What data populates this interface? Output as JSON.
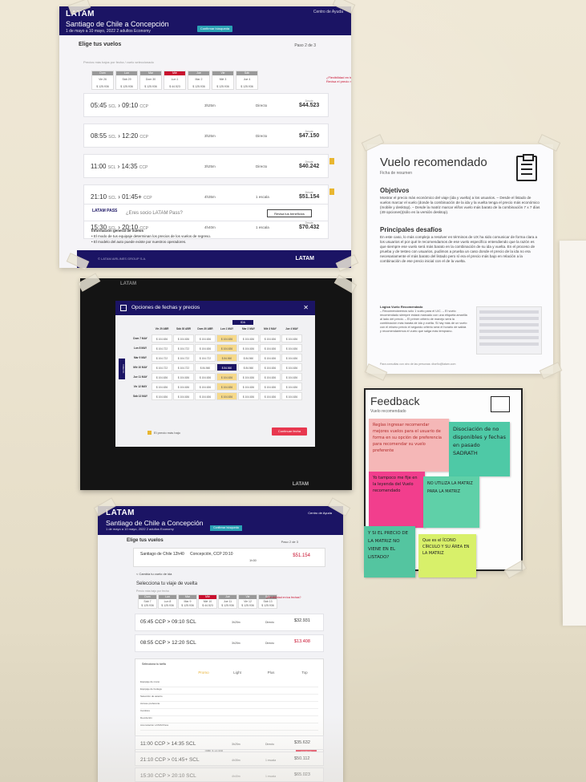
{
  "poster1": {
    "brand": "LATAM",
    "route": "Santiago de Chile a Concepción",
    "subtitle": "1 de mayo a 10 mayo, 2022   2 adultos   Economy",
    "help": "Centro de Ayuda",
    "confirm": "Confirmar búsqueda",
    "title": "Elige tus vuelos",
    "step": "Paso 2 de 3",
    "note": "Precios más bajos por fecha / vuelo seleccionado",
    "dates": [
      {
        "day": "Dom",
        "label": "Vie 26",
        "price": "$ 125.936",
        "selected": false
      },
      {
        "day": "Lun",
        "label": "Sáb 29",
        "price": "$ 125.936",
        "selected": false
      },
      {
        "day": "Mar",
        "label": "Dom 30",
        "price": "$ 125.936",
        "selected": false
      },
      {
        "day": "Mié",
        "label": "Lun 1",
        "price": "$ 44.523",
        "selected": true
      },
      {
        "day": "Jue",
        "label": "Mar 2",
        "price": "$ 125.936",
        "selected": false
      },
      {
        "day": "Vie",
        "label": "Mié 3",
        "price": "$ 125.936",
        "selected": false
      },
      {
        "day": "Sáb",
        "label": "Jue 4",
        "price": "$ 125.936",
        "selected": false
      }
    ],
    "promo": "¿Flexibilidad en tus fechas? Revisa el precio más bajo",
    "flights": [
      {
        "dep": "05:45",
        "from": "SCL",
        "arr": "09:10",
        "to": "CCP",
        "duration": "3h25m",
        "stops": "Directo",
        "from_label": "Desde",
        "price": "$44.523",
        "flag": false
      },
      {
        "dep": "08:55",
        "from": "SCL",
        "arr": "12:20",
        "to": "CCP",
        "duration": "3h25m",
        "stops": "Directo",
        "from_label": "Desde",
        "price": "$47.150",
        "flag": false
      },
      {
        "dep": "11:00",
        "from": "SCL",
        "arr": "14:35",
        "to": "CCP",
        "duration": "3h25m",
        "stops": "Directo",
        "from_label": "Desde",
        "price": "$40.242",
        "flag": true
      },
      {
        "dep": "21:10",
        "from": "SCL",
        "arr": "01:45+",
        "to": "CCP",
        "duration": "4h35m",
        "stops": "1 escala",
        "from_label": "Desde",
        "price": "$51.154",
        "flag": true
      },
      {
        "dep": "15:30",
        "from": "SCL",
        "arr": "20:10",
        "to": "CCP",
        "duration": "4h40m",
        "stops": "1 escala",
        "from_label": "Desde",
        "price": "$70.432",
        "flag": false
      }
    ],
    "pass_logo": "LATAM PASS",
    "pass_question": "¿Eres socio LATAM Pass?",
    "pass_button": "Revisa tus beneficios",
    "info_title": "Información general de vuelos",
    "info_1": "• El modo de tus equipaje determinan los precios de los vuelos de regreso.",
    "info_2": "• El modelo del auto puede existe por nuestros operadores.",
    "footer_brand": "LATAM",
    "footer_small": "© LATAM AIRLINES GROUP S.A."
  },
  "poster2": {
    "brand": "LATAM",
    "modal_title": "Opciones de fechas y precios",
    "close": "✕",
    "ida": "IDA",
    "vuelta": "VUELTA",
    "col_headers": [
      "",
      "Vie 29 ABR",
      "Sáb 30 ABR",
      "Dom 30 ABR",
      "Lun 1 MAY",
      "Mar 2 MAY",
      "Mié 3 MAY",
      "Jue 4 MAY"
    ],
    "rows": [
      {
        "label": "Dom 7 MAY",
        "cells": [
          "$ 104.636",
          "$ 104.636",
          "$ 104.636",
          "$ 104.636",
          "$ 104.636",
          "$ 104.636",
          "$ 104.636"
        ]
      },
      {
        "label": "Lun 8 MAY",
        "cells": [
          "$ 104.722",
          "$ 104.722",
          "$ 104.636",
          "$ 104.636",
          "$ 104.636",
          "$ 104.636",
          "$ 104.636"
        ]
      },
      {
        "label": "Mar 9 MAY",
        "cells": [
          "$ 104.722",
          "$ 104.722",
          "$ 104.722",
          "$ 84.560",
          "$ 84.560",
          "$ 104.636",
          "$ 104.636"
        ]
      },
      {
        "label": "Mié 10 MAY",
        "cells": [
          "$ 104.722",
          "$ 104.722",
          "$ 84.560",
          "$ 84.560",
          "$ 84.560",
          "$ 104.636",
          "$ 104.636"
        ]
      },
      {
        "label": "Jue 11 MAY",
        "cells": [
          "$ 104.636",
          "$ 104.636",
          "$ 104.636",
          "$ 104.636",
          "$ 104.636",
          "$ 104.636",
          "$ 104.636"
        ]
      },
      {
        "label": "Vie 12 MAY",
        "cells": [
          "$ 104.636",
          "$ 104.636",
          "$ 104.636",
          "$ 104.636",
          "$ 104.636",
          "$ 104.636",
          "$ 104.636"
        ]
      },
      {
        "label": "Sáb 13 MAY",
        "cells": [
          "$ 104.636",
          "$ 104.636",
          "$ 104.636",
          "$ 104.636",
          "$ 104.636",
          "$ 104.636",
          "$ 104.636"
        ]
      }
    ],
    "legend": "El precio más bajo",
    "continue": "Continuar fecha",
    "footer_brand": "LATAM"
  },
  "poster3": {
    "brand": "LATAM",
    "route": "Santiago de Chile a Concepción",
    "subtitle": "1 de mayo a 10 mayo, 2022   2 adultos   Economy",
    "help": "Centro de Ayuda",
    "confirm": "Confirmar búsqueda",
    "title": "Elige tus vuelos",
    "step": "Paso 2 de 3",
    "selected_from": "Santiago de Chile  12h40",
    "selected_to": "Concepción, CCP  20:10",
    "selected_duration": "1h30",
    "selected_price": "$51.154",
    "back": "< Cambia tu vuelo de ida",
    "section": "Selecciona tu viaje de vuelta",
    "note": "Precio más bajo por fecha",
    "dates": [
      {
        "day": "Dom",
        "label": "Sáb 7",
        "price": "$ 125.936",
        "selected": false
      },
      {
        "day": "Lun",
        "label": "Lun 8",
        "price": "$ 125.936",
        "selected": false
      },
      {
        "day": "Mar",
        "label": "Mar 9",
        "price": "$ 125.936",
        "selected": false
      },
      {
        "day": "Mié",
        "label": "Mié 10",
        "price": "$ 44.523",
        "selected": true
      },
      {
        "day": "Jue",
        "label": "Jue 11",
        "price": "$ 125.936",
        "selected": false
      },
      {
        "day": "Vie",
        "label": "Vie 12",
        "price": "$ 125.936",
        "selected": false
      },
      {
        "day": "Sáb",
        "label": "Sáb 13",
        "price": "$ 125.936",
        "selected": false
      }
    ],
    "promo": "¿Flexibilidad en tus fechas?",
    "flights_top": [
      {
        "time": "05:45 CCP > 09:10 SCL",
        "duration": "3h25m",
        "stops": "Directo",
        "price": "$32.931",
        "red": false
      },
      {
        "time": "08:55 CCP > 12:20 SCL",
        "duration": "3h25m",
        "stops": "Directo",
        "price": "$13.408",
        "red": true
      }
    ],
    "fare_title": "Selecciona tu tarifa",
    "fare_cols": [
      "Promo",
      "Light",
      "Plus",
      "Top"
    ],
    "fare_rows": [
      "Equipaje de mano",
      "Equipaje de bodega",
      "Selección de asiento",
      "Acceso preferente",
      "Cambios",
      "Devolución",
      "Acumulación LATAM Pass"
    ],
    "fare_total": "Total: $ 13.408",
    "fare_continue": "Continuar",
    "flights_bottom": [
      {
        "time": "11:00 CCP > 14:35 SCL",
        "duration": "3h25m",
        "stops": "Directo",
        "price": "$35.632"
      },
      {
        "time": "21:10 CCP > 01:45+ SCL",
        "duration": "4h35m",
        "stops": "1 escala",
        "price": "$50.112"
      },
      {
        "time": "15:30 CCP > 20:10 SCL",
        "duration": "4h40m",
        "stops": "1 escala",
        "price": "$65.023"
      }
    ]
  },
  "doc": {
    "title": "Vuelo recomendado",
    "ficha": "Ficha de resumen",
    "obj_title": "Objetivos",
    "obj_text": "Mostrar el precio más económico del viaje (ida y vuelta) a los usuarios. – Desde el listado de vuelos marcar el vuelo (donde la combinación de la ida y la vuelta tenga el precio más económico (mobile y desktop). – Desde la matriz marcar el/los vuelo más barato de la combinación 7 x 7 días (49 opciones)(sólo en la versión desktop).",
    "des_title": "Principales desafíos",
    "des_text": "En este caso, lo más complejo a resolver en términos de UX ha sido comunicar de forma clara a los usuarios el por qué le recomendamos de ese vuelo específico entendiendo que la razón es que siempre ese vuelo será más barato en la combinación de su ida y vuelta. En el proceso de prueba y de testeo con usuarios, pudimos a prueba un caso donde el precio de la ida no era necesariamente el más barato del listado pero sí era el precio más bajo en relación a la combinación de ese precio inicial con el de la vuelta.",
    "logic_title": "Lógica Vuelo Recomendado",
    "logic_text": "– Recomendaremos sólo 1 vuelo para el U/C. – El vuelo recomendado siempre estará marcado con una etiqueta amarilla al lado del precio. – El primer criterio de manejo será la combinación más barata de ida y vuelta. Si hay más de un vuelo con el mismo precio el segundo criterio será el horario de salida y recomendaremos el vuelo que salga más temprano.",
    "footnote": "Para consultas con otro de las personas: diseño@latam.com"
  },
  "feedback": {
    "title": "Feedback",
    "subtitle": "Vuelo recomendado",
    "notes": [
      "Reglas ingresar recomendar mejores vuelos para el usuario de forma en su opción de preferencia para recomendar su vuelo preferente",
      "Disociación de no disponibles y fechas en pasado SADRATH",
      "Yo tampoco me fije en la leyenda del Vuelo recomendado",
      "NO UTILIZA LA MATRIZ PARA LA MATRIZ",
      "Y SI EL PRECIO DE LA MATRIZ NO VIENE EN EL LISTADO?",
      "Que es el ÍCONO CÍRCULO Y SU ÁREA EN LA MATRIZ"
    ]
  }
}
